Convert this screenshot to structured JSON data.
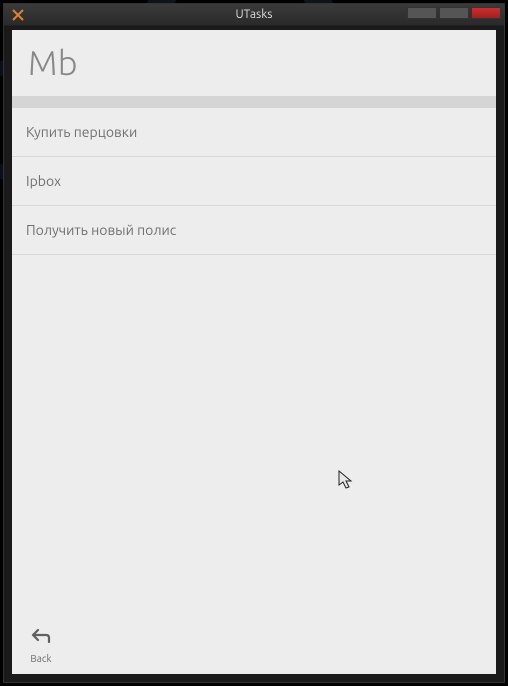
{
  "window": {
    "title": "UTasks"
  },
  "header": {
    "title": "Mb"
  },
  "tasks": [
    {
      "label": "Купить перцовки"
    },
    {
      "label": "Ipbox"
    },
    {
      "label": "Получить новый полис"
    }
  ],
  "footer": {
    "back_label": "Back"
  }
}
